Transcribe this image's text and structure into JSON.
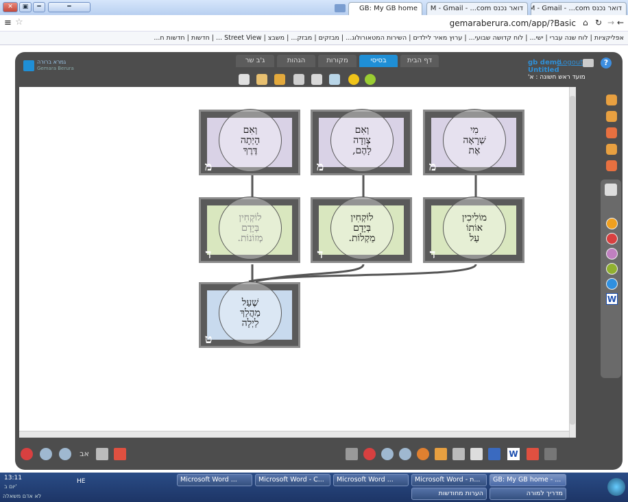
{
  "browser": {
    "window_buttons": [
      "✕",
      "▣",
      "━"
    ],
    "min_button_label": "━",
    "tabs": [
      {
        "label": "GB: My GB home",
        "active": true
      },
      {
        "label": "דואר נכנס M - Gmail - ...com",
        "active": false
      },
      {
        "label": "דואר נכנס M - Gmail - ...com",
        "active": false
      }
    ],
    "url": "gemaraberura.com/app/?Basic",
    "bookmarks": "אפליקציות | לוח שנה עברי | ישי... | לוח קדושה שבועי... | ערוץ מאיר לילדים | השירות המטאורולוג... | מבזקים | מבזק... | משבצ | Street View ... | חדשות | חדשות ח..."
  },
  "app": {
    "logo_line1": "גמרא ברורה",
    "logo_line2": "Gemara Berura",
    "user": "gb demo",
    "logout": "(Logout)",
    "document_title": "Untitled",
    "location": "מועד ראש חשונה : א'",
    "top_tabs": [
      "דף הבית",
      "בסיסי",
      "מקורות",
      "הגהות",
      "ג'ב שר"
    ],
    "active_tab": "בסיסי"
  },
  "nodes": [
    {
      "id": "n1",
      "badge": "מ",
      "text": "מִי\nשְׁרָאָה\nאֶת",
      "color": "#d9d2e6"
    },
    {
      "id": "n2",
      "badge": "מ",
      "text": "וְאִם\nצְוְדָה\nלָהֶם,",
      "color": "#d9d2e6"
    },
    {
      "id": "n3",
      "badge": "מ",
      "text": "וְאִם\nהָיְתָה\nדֶּרֶךְ",
      "color": "#d9d2e6"
    },
    {
      "id": "n4",
      "badge": "ד",
      "text": "מוֹלִיכִין\nאוֹתוֹ\nעַל",
      "color": "#d9e7bf"
    },
    {
      "id": "n5",
      "badge": "ד",
      "text": "לוֹקְחִין\nבְּיָדָם\nמַקְלוֹת.",
      "color": "#d9e7bf"
    },
    {
      "id": "n6",
      "badge": "ד",
      "text": "לוֹקְחִין\nבְּיָדָם\nמְזוֹנוֹת.",
      "color": "#d9e7bf"
    },
    {
      "id": "n7",
      "badge": "ט",
      "text": "שֶׁעַל\nמַהֲלַךְ\nלַיְלָה",
      "color": "#c8daee"
    }
  ],
  "taskbar": {
    "clock": "13:11",
    "day": "יום ב'",
    "lang": "HE",
    "tasks_row1": [
      "Microsoft Word ...",
      "Microsoft Word - C...",
      "Microsoft Word ...",
      "Microsoft Word - ת...",
      "GB: My GB home - ..."
    ],
    "tasks_row2": [
      "הערות מחודשות",
      "מדריך למורה"
    ],
    "bottom_left": "לא אדם משאלה"
  },
  "colors": {
    "app_bg": "#4d4d4d",
    "active_tab": "#1f8fd6",
    "connector": "#555555"
  }
}
